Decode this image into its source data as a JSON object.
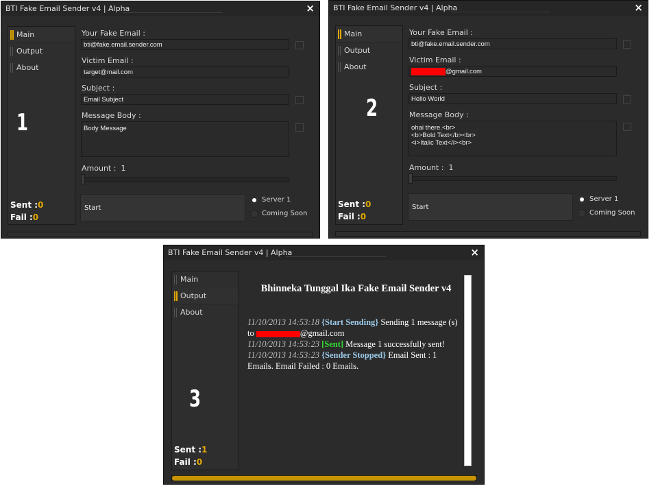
{
  "window": {
    "title": "BTI Fake Email Sender v4 | Alpha",
    "close_glyph": "×"
  },
  "nav": {
    "main": "Main",
    "output": "Output",
    "about": "About"
  },
  "form": {
    "fake_email_label": "Your Fake Email :",
    "victim_email_label": "Victim Email :",
    "subject_label": "Subject :",
    "message_label": "Message Body :",
    "amount_label": "Amount :",
    "start_label": "Start",
    "server1_label": "Server 1",
    "coming_soon_label": "Coming Soon"
  },
  "panel1": {
    "number": "1",
    "fake_email": "bti@fake.email.sender.com",
    "victim_email": "target@mail.com",
    "subject": "Email Subject",
    "message": "Body Message",
    "amount": "1",
    "sent_label": "Sent :",
    "sent": "0",
    "fail_label": "Fail :",
    "fail": "0"
  },
  "panel2": {
    "number": "2",
    "fake_email": "bti@fake.email.sender.com",
    "victim_email_suffix": "@gmail.com",
    "subject": "Hello World",
    "message": "ohai there.<br>\n<b>Bold Text</b><br>\n<i>Italic Text</i><br>",
    "amount": "1",
    "sent_label": "Sent :",
    "sent": "0",
    "fail_label": "Fail :",
    "fail": "0"
  },
  "panel3": {
    "number": "3",
    "output_title": "Bhinneka Tunggal Ika Fake Email Sender v4",
    "log": {
      "l1_ts": "11/10/2013 14:53:18",
      "l1_tag": "{Start Sending}",
      "l1_text": "Sending 1 message (s) to",
      "l1_suffix": "@gmail.com",
      "l2_ts": "11/10/2013 14:53:23",
      "l2_tag": "[Sent]",
      "l2_text": "Message 1 successfully sent!",
      "l3_ts": "11/10/2013 14:53:23",
      "l3_tag": "{Sender Stopped}",
      "l3_text": "Email Sent : 1 Emails. Email Failed : 0 Emails."
    },
    "progress_fraction": 1.0,
    "sent_label": "Sent :",
    "sent": "1",
    "fail_label": "Fail :",
    "fail": "0"
  },
  "colors": {
    "window_bg": "#2b2b2b",
    "accent": "#e1a800",
    "redaction": "#ff0000"
  }
}
